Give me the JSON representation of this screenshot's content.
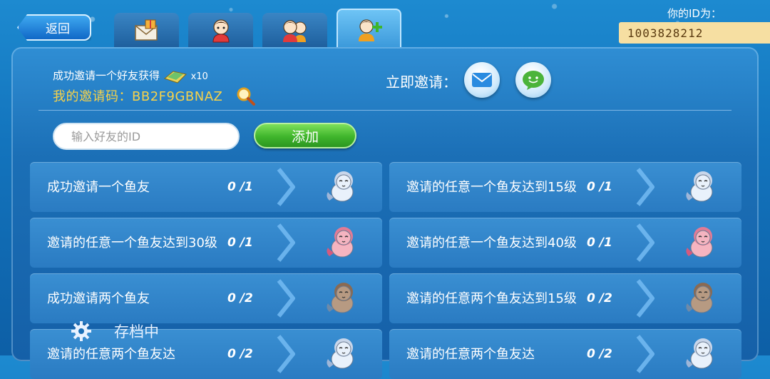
{
  "header": {
    "back_label": "返回",
    "tabs": [
      {
        "icon": "mail-gift-icon",
        "active": false
      },
      {
        "icon": "single-friend-icon",
        "active": false
      },
      {
        "icon": "two-friends-icon",
        "active": false
      },
      {
        "icon": "add-friend-icon",
        "active": true
      }
    ],
    "id_label": "你的ID为：",
    "id_value": "1003828212"
  },
  "invite": {
    "reward_text": "成功邀请一个好友获得",
    "reward_count": "x10",
    "code_text": "我的邀请码：BB2F9GBNAZ",
    "invite_now_label": "立即邀请："
  },
  "add_friend": {
    "placeholder": "输入好友的ID",
    "add_label": "添加"
  },
  "tasks": [
    {
      "title": "成功邀请一个鱼友",
      "progress": "0 /1",
      "fish_color": "white"
    },
    {
      "title": "邀请的任意一个鱼友达到15级",
      "progress": "0 /1",
      "fish_color": "white"
    },
    {
      "title": "邀请的任意一个鱼友达到30级",
      "progress": "0 /1",
      "fish_color": "pink"
    },
    {
      "title": "邀请的任意一个鱼友达到40级",
      "progress": "0 /1",
      "fish_color": "pink"
    },
    {
      "title": "成功邀请两个鱼友",
      "progress": "0 /2",
      "fish_color": "brown"
    },
    {
      "title": "邀请的任意两个鱼友达到15级",
      "progress": "0 /2",
      "fish_color": "brown"
    },
    {
      "title": "邀请的任意两个鱼友达",
      "progress": "0 /2",
      "fish_color": "white"
    },
    {
      "title": "邀请的任意两个鱼友达",
      "progress": "0 /2",
      "fish_color": "white"
    }
  ],
  "status": {
    "saving_text": "存档中"
  },
  "colors": {
    "code_gold": "#f7d24a",
    "add_green": "#3fb52c",
    "panel_blue": "#1b6fb6"
  }
}
